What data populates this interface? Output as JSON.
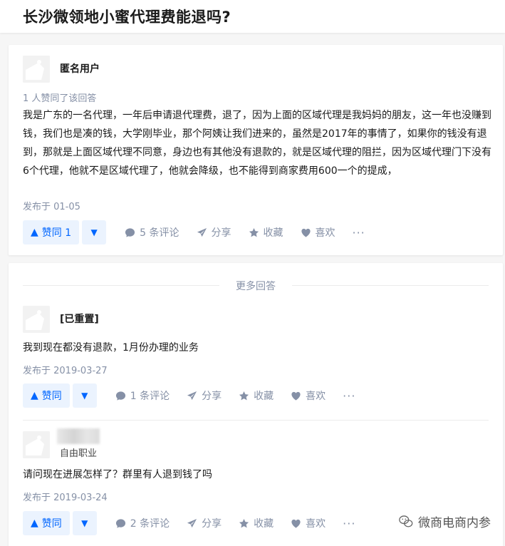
{
  "question": {
    "title": "长沙微领地小蜜代理费能退吗?"
  },
  "answer1": {
    "author": "匿名用户",
    "votes_text": "1 人赞同了该回答",
    "content": "我是广东的一名代理，一年后申请退代理费，退了，因为上面的区域代理是我妈妈的朋友，这一年也没赚到钱，我们也是凑的钱，大学刚毕业，那个阿姨让我们进来的，虽然是2017年的事情了，如果你的钱没有退到，那就是上面区域代理不同意，身边也有其他没有退款的，就是区域代理的阻拦，因为区域代理门下没有6个代理，他就不是区域代理了，他就会降级，也不能得到商家费用600一个的提成，",
    "published": "发布于 01-05",
    "vote_up": "赞同 1",
    "comments": "5 条评论",
    "share": "分享",
    "collect": "收藏",
    "like": "喜欢",
    "more": "···"
  },
  "more_answers_label": "更多回答",
  "answer2": {
    "author": "[已重置]",
    "content": "我到现在都没有退款，1月份办理的业务",
    "published": "发布于 2019-03-27",
    "vote_up": "赞同",
    "comments": "1 条评论",
    "share": "分享",
    "collect": "收藏",
    "like": "喜欢",
    "more": "···"
  },
  "answer3": {
    "author_sub": "自由职业",
    "content": "请问现在进展怎样了？群里有人退到钱了吗",
    "published": "发布于 2019-03-24",
    "vote_up": "赞同",
    "comments": "2 条评论",
    "share": "分享",
    "collect": "收藏",
    "like": "喜欢",
    "more": "···"
  },
  "watermark": {
    "text": "微商电商内参"
  },
  "icons": {
    "vote_up": "triangle-up-icon",
    "vote_down": "triangle-down-icon",
    "comment": "comment-bubble-icon",
    "share": "paper-plane-icon",
    "collect": "star-icon",
    "like": "heart-icon",
    "avatar": "default-avatar-icon",
    "watermark_logo": "wechat-icon"
  },
  "colors": {
    "accent": "#0066ff",
    "accent_bg": "#ebf3fe",
    "meta": "#8590a6"
  }
}
